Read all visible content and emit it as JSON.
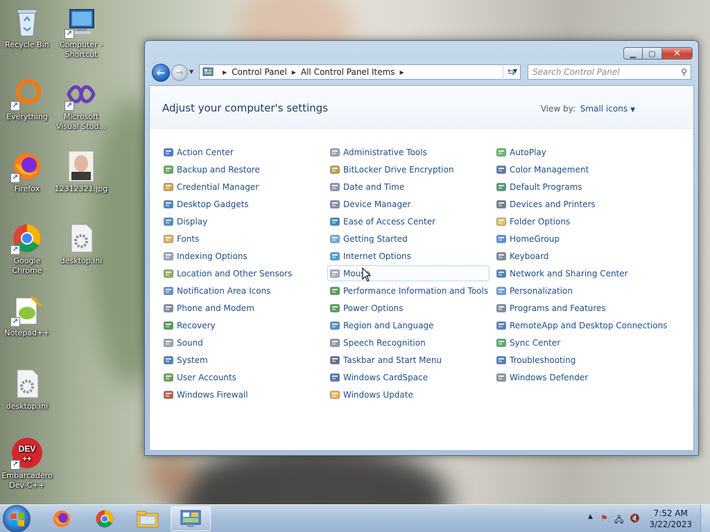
{
  "desktop": {
    "icons": [
      {
        "label": "Recycle Bin",
        "icon": "recycle-bin-icon"
      },
      {
        "label": "Computer - Shortcut",
        "icon": "computer-icon"
      },
      {
        "label": "Everything",
        "icon": "everything-icon"
      },
      {
        "label": "Microsoft Visual Stud...",
        "icon": "visual-studio-icon"
      },
      {
        "label": "Firefox",
        "icon": "firefox-icon"
      },
      {
        "label": "12312321.jpg",
        "icon": "image-file-icon"
      },
      {
        "label": "Google Chrome",
        "icon": "chrome-icon"
      },
      {
        "label": "desktop.ini",
        "icon": "ini-file-icon"
      },
      {
        "label": "Notepad++",
        "icon": "notepadpp-icon"
      },
      {
        "label": "desktop.ini",
        "icon": "ini-file-icon"
      },
      {
        "label": "Embarcadero Dev-C++",
        "icon": "devcpp-icon"
      }
    ]
  },
  "window": {
    "breadcrumb": [
      "Control Panel",
      "All Control Panel Items"
    ],
    "search_placeholder": "Search Control Panel",
    "title": "Adjust your computer's settings",
    "view_by_label": "View by:",
    "view_by_value": "Small icons",
    "items": [
      {
        "label": "Action Center",
        "icon": "flag-icon"
      },
      {
        "label": "Administrative Tools",
        "icon": "admin-tools-icon"
      },
      {
        "label": "AutoPlay",
        "icon": "autoplay-icon"
      },
      {
        "label": "Backup and Restore",
        "icon": "backup-icon"
      },
      {
        "label": "BitLocker Drive Encryption",
        "icon": "bitlocker-icon"
      },
      {
        "label": "Color Management",
        "icon": "color-management-icon"
      },
      {
        "label": "Credential Manager",
        "icon": "credential-icon"
      },
      {
        "label": "Date and Time",
        "icon": "clock-icon"
      },
      {
        "label": "Default Programs",
        "icon": "default-programs-icon"
      },
      {
        "label": "Desktop Gadgets",
        "icon": "gadgets-icon"
      },
      {
        "label": "Device Manager",
        "icon": "device-manager-icon"
      },
      {
        "label": "Devices and Printers",
        "icon": "printer-icon"
      },
      {
        "label": "Display",
        "icon": "display-icon"
      },
      {
        "label": "Ease of Access Center",
        "icon": "ease-of-access-icon"
      },
      {
        "label": "Folder Options",
        "icon": "folder-icon"
      },
      {
        "label": "Fonts",
        "icon": "fonts-icon"
      },
      {
        "label": "Getting Started",
        "icon": "getting-started-icon"
      },
      {
        "label": "HomeGroup",
        "icon": "homegroup-icon"
      },
      {
        "label": "Indexing Options",
        "icon": "indexing-icon"
      },
      {
        "label": "Internet Options",
        "icon": "internet-icon"
      },
      {
        "label": "Keyboard",
        "icon": "keyboard-icon"
      },
      {
        "label": "Location and Other Sensors",
        "icon": "sensors-icon"
      },
      {
        "label": "Mouse",
        "icon": "mouse-icon"
      },
      {
        "label": "Network and Sharing Center",
        "icon": "network-icon"
      },
      {
        "label": "Notification Area Icons",
        "icon": "notification-icon"
      },
      {
        "label": "Performance Information and Tools",
        "icon": "performance-icon"
      },
      {
        "label": "Personalization",
        "icon": "personalization-icon"
      },
      {
        "label": "Phone and Modem",
        "icon": "phone-icon"
      },
      {
        "label": "Power Options",
        "icon": "power-icon"
      },
      {
        "label": "Programs and Features",
        "icon": "programs-icon"
      },
      {
        "label": "Recovery",
        "icon": "recovery-icon"
      },
      {
        "label": "Region and Language",
        "icon": "region-icon"
      },
      {
        "label": "RemoteApp and Desktop Connections",
        "icon": "remoteapp-icon"
      },
      {
        "label": "Sound",
        "icon": "sound-icon"
      },
      {
        "label": "Speech Recognition",
        "icon": "microphone-icon"
      },
      {
        "label": "Sync Center",
        "icon": "sync-icon"
      },
      {
        "label": "System",
        "icon": "system-icon"
      },
      {
        "label": "Taskbar and Start Menu",
        "icon": "taskbar-icon"
      },
      {
        "label": "Troubleshooting",
        "icon": "troubleshooting-icon"
      },
      {
        "label": "User Accounts",
        "icon": "users-icon"
      },
      {
        "label": "Windows CardSpace",
        "icon": "cardspace-icon"
      },
      {
        "label": "Windows Defender",
        "icon": "defender-icon"
      },
      {
        "label": "Windows Firewall",
        "icon": "firewall-icon"
      },
      {
        "label": "Windows Update",
        "icon": "update-icon"
      }
    ],
    "hovered_item": "Mouse"
  },
  "taskbar": {
    "buttons": [
      "firefox-icon",
      "chrome-icon",
      "explorer-icon",
      "control-panel-icon"
    ],
    "active": "control-panel-icon",
    "clock_time": "7:52 AM",
    "clock_date": "3/22/2023"
  },
  "colors": {
    "link": "#1e4e8c",
    "title": "#1e395b",
    "close": "#c94532"
  }
}
